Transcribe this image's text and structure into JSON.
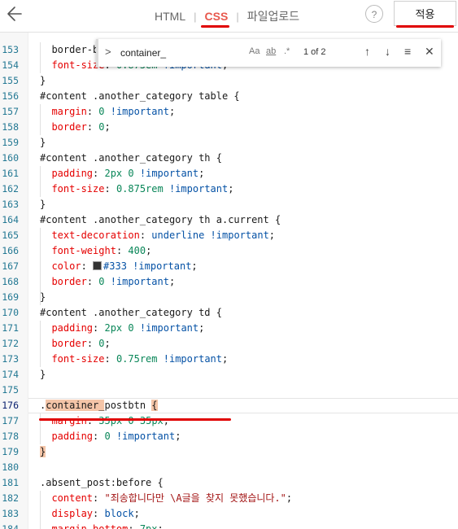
{
  "toolbar": {
    "tabs": [
      "HTML",
      "CSS",
      "파일업로드"
    ],
    "help": "?",
    "apply_label": "적용"
  },
  "find": {
    "chevron": ">",
    "query": "container_",
    "opt_case": "Aa",
    "opt_word": "ab",
    "opt_regex": ".*",
    "count": "1 of 2",
    "up": "↑",
    "down": "↓",
    "selection": "≡",
    "close": "✕"
  },
  "colors": {
    "accent": "#e8584d",
    "marker": "#e00000",
    "match": "#f4c5a8"
  },
  "lines": [
    {
      "n": "153",
      "t": "  border-b"
    },
    {
      "n": "154",
      "t": "  font-size: 0.875em !important;"
    },
    {
      "n": "155",
      "t": "}"
    },
    {
      "n": "156",
      "t": "#content .another_category table {"
    },
    {
      "n": "157",
      "t": "  margin: 0 !important;"
    },
    {
      "n": "158",
      "t": "  border: 0;"
    },
    {
      "n": "159",
      "t": "}"
    },
    {
      "n": "160",
      "t": "#content .another_category th {"
    },
    {
      "n": "161",
      "t": "  padding: 2px 0 !important;"
    },
    {
      "n": "162",
      "t": "  font-size: 0.875rem !important;"
    },
    {
      "n": "163",
      "t": "}"
    },
    {
      "n": "164",
      "t": "#content .another_category th a.current {"
    },
    {
      "n": "165",
      "t": "  text-decoration: underline !important;"
    },
    {
      "n": "166",
      "t": "  font-weight: 400;"
    },
    {
      "n": "167",
      "t": "  color: #333 !important;"
    },
    {
      "n": "168",
      "t": "  border: 0 !important;"
    },
    {
      "n": "169",
      "t": "}"
    },
    {
      "n": "170",
      "t": "#content .another_category td {"
    },
    {
      "n": "171",
      "t": "  padding: 2px 0 !important;"
    },
    {
      "n": "172",
      "t": "  border: 0;"
    },
    {
      "n": "173",
      "t": "  font-size: 0.75rem !important;"
    },
    {
      "n": "174",
      "t": "}"
    },
    {
      "n": "175",
      "t": ""
    },
    {
      "n": "176",
      "t": ".container_postbtn {"
    },
    {
      "n": "177",
      "t": "  margin: 35px 0 35px;"
    },
    {
      "n": "178",
      "t": "  padding: 0 !important;"
    },
    {
      "n": "179",
      "t": "}"
    },
    {
      "n": "180",
      "t": ""
    },
    {
      "n": "181",
      "t": ".absent_post:before {"
    },
    {
      "n": "182",
      "t": "  content: \"죄송합니다만 \\A글을 찾지 못했습니다.\";"
    },
    {
      "n": "183",
      "t": "  display: block;"
    },
    {
      "n": "184",
      "t": "  margin-bottom: 7px;"
    }
  ]
}
